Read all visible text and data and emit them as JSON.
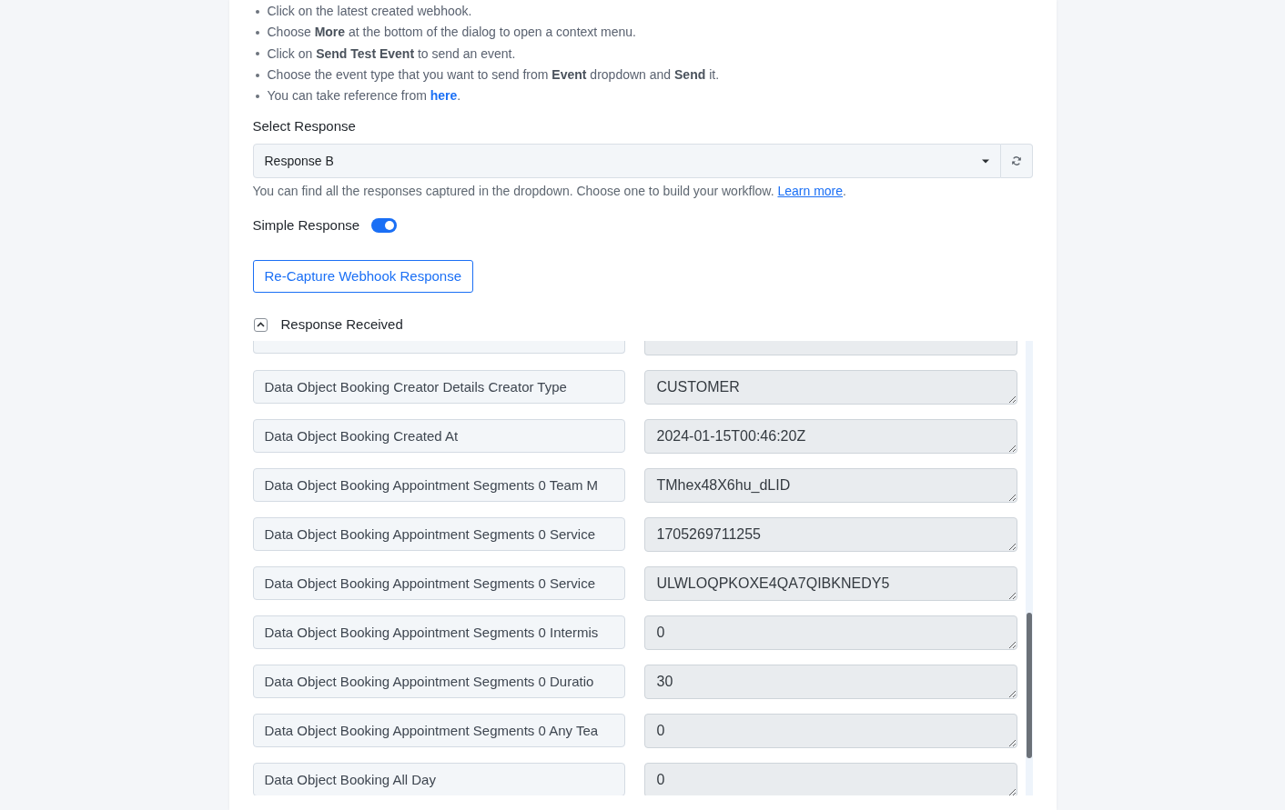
{
  "instructions": [
    {
      "text": "Click on the latest created webhook."
    },
    {
      "text": "Choose **More** at the bottom of the dialog to open a context menu."
    },
    {
      "text": "Click on **Send Test Event** to send an event."
    },
    {
      "text": "Choose the event type that you want to send from **Event** dropdown and **Send** it."
    },
    {
      "text": "You can take reference from",
      "link": "here",
      "after": "."
    }
  ],
  "select_response": {
    "label": "Select Response",
    "value": "Response B",
    "help": "You can find all the responses captured in the dropdown. Choose one to build your workflow.",
    "help_link": "Learn more",
    "help_after": "."
  },
  "simple_response": {
    "label": "Simple Response",
    "on": true
  },
  "recapture_button": "Re-Capture Webhook Response",
  "response_received": {
    "title": "Response Received",
    "expanded": true,
    "fields": [
      {
        "key": "Data Object Booking Creator Details Creator Type",
        "value": "CUSTOMER"
      },
      {
        "key": "Data Object Booking Created At",
        "value": "2024-01-15T00:46:20Z"
      },
      {
        "key": "Data Object Booking Appointment Segments 0 Team M",
        "value": "TMhex48X6hu_dLID"
      },
      {
        "key": "Data Object Booking Appointment Segments 0 Service",
        "value": "1705269711255"
      },
      {
        "key": "Data Object Booking Appointment Segments 0 Service",
        "value": "ULWLOQPKOXE4QA7QIBKNEDY5"
      },
      {
        "key": "Data Object Booking Appointment Segments 0 Intermis",
        "value": "0"
      },
      {
        "key": "Data Object Booking Appointment Segments 0 Duratio",
        "value": "30"
      },
      {
        "key": "Data Object Booking Appointment Segments 0 Any Tea",
        "value": "0"
      },
      {
        "key": "Data Object Booking All Day",
        "value": "0"
      }
    ]
  }
}
